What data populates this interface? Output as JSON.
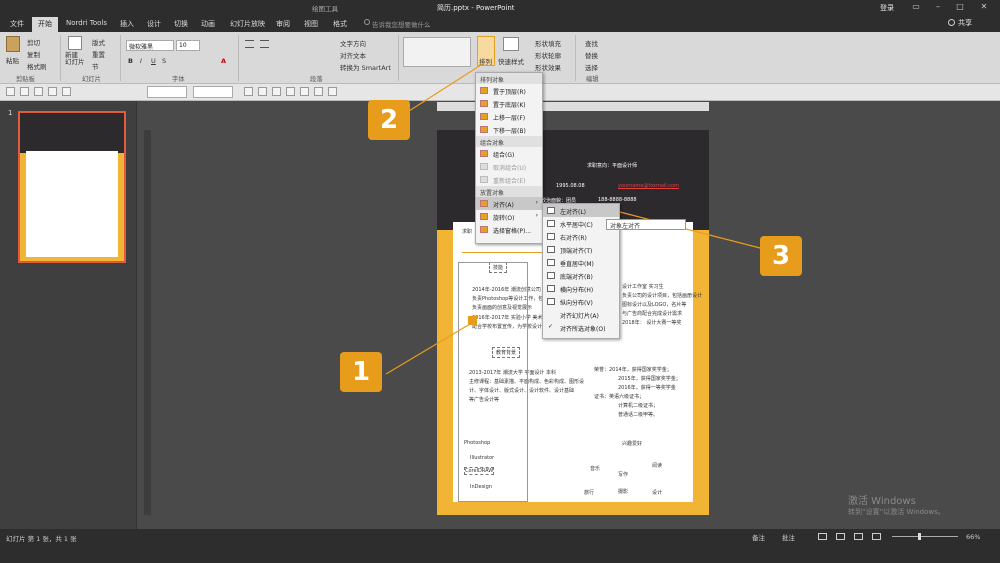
{
  "window": {
    "context_label": "绘图工具",
    "title": "简历.pptx - PowerPoint",
    "sign_in": "登录",
    "share": "共享",
    "tell_me": "告诉我您想要做什么"
  },
  "tabs": [
    "文件",
    "开始",
    "Nordri Tools",
    "插入",
    "设计",
    "切换",
    "动画",
    "幻灯片放映",
    "审阅",
    "视图",
    "格式"
  ],
  "active_tab": "开始",
  "ribbon": {
    "paste": "粘贴",
    "cut": "剪切",
    "copy": "复制",
    "format_painter": "格式刷",
    "new_slide": "新建\n幻灯片",
    "layout": "版式",
    "reset": "重置",
    "section": "节",
    "font_name": "微软雅黑",
    "font_size": "10",
    "text_direction": "文字方向",
    "align_text": "对齐文本",
    "smartart": "转换为 SmartArt",
    "arrange": "排列",
    "quick_styles": "快速样式",
    "shape_fill": "形状填充",
    "shape_outline": "形状轮廓",
    "shape_effects": "形状效果",
    "find": "查找",
    "replace": "替换",
    "select": "选择",
    "groups": [
      "剪贴板",
      "幻灯片",
      "字体",
      "段落",
      "编辑"
    ]
  },
  "thumbnail": {
    "number": "1"
  },
  "slide": {
    "objective": "求职意向：平面设计师",
    "birth": "1995.08.08",
    "email": "yourname@foxmail.com",
    "politics": "政治面貌：团员",
    "phone": "188-8888-8888",
    "name_label": "求职",
    "section_skills": "技能",
    "line1": "2014年-2016年    潮流创意公司",
    "line2": "负责Photoshop等设计工作，包括海报设计，",
    "line3": "负责画面的创意及视觉展示",
    "line4": "2016年-2017年    实验小学    美术",
    "line5": "配合学校布置宣传，为学校设计",
    "section_edu": "教育背景",
    "edu1": "2013-2017年   潮流大学   平面设计   本科",
    "edu2": "主修课程：基础素描、平面构成、色彩构成、图形设",
    "edu3": "计、字体设计、版式设计、设计软件、设计基础",
    "edu4": "等广告设计等",
    "right1": "设计工作室    实习生",
    "right2": "负责公司的设计项目，包括画册设计",
    "right3": "图标设计以及LOGO，名片等",
    "right4": "与广告商配合完成设计需求",
    "right5": "2018年：   设计大赛一等奖",
    "honor1": "荣誉：2014年，获得国家奖学金；",
    "honor2": "2015年，获得国家奖学金；",
    "honor3": "2016年，获得一等奖学金",
    "honor4": "证书：英语六级证书；",
    "honor5": "计算机二级证书；",
    "honor6": "普通话二级甲等。",
    "interest": "兴趣爱好",
    "hobby1": "音乐",
    "hobby2": "写作",
    "hobby3": "阅读",
    "hobby4": "旅行",
    "hobby5": "摄影",
    "hobby6": "设计",
    "sw1": "Photoshop",
    "sw2": "Illustrator",
    "sw3": "CorelDRAW",
    "sw4": "InDesign"
  },
  "arrange_menu": {
    "h_order": "排列对象",
    "bring_front": "置于顶层(R)",
    "send_back": "置于底层(K)",
    "forward": "上移一层(F)",
    "backward": "下移一层(B)",
    "h_group": "组合对象",
    "group": "组合(G)",
    "ungroup": "取消组合(U)",
    "regroup": "重新组合(E)",
    "h_position": "放置对象",
    "align": "对齐(A)",
    "rotate": "旋转(O)",
    "selection_pane": "选择窗格(P)..."
  },
  "align_menu": {
    "left": "左对齐(L)",
    "center": "水平居中(C)",
    "right": "右对齐(R)",
    "top": "顶端对齐(T)",
    "middle": "垂直居中(M)",
    "bottom": "底端对齐(B)",
    "dist_h": "横向分布(H)",
    "dist_v": "纵向分布(V)",
    "to_slide": "对齐幻灯片(A)",
    "to_selected": "对齐所选对象(O)"
  },
  "tooltip": "对象左对齐",
  "badges": [
    "1",
    "2",
    "3"
  ],
  "status": {
    "slide_count": "幻灯片 第 1 张，共 1 张",
    "notes": "备注",
    "comments": "批注",
    "zoom": "66%"
  },
  "watermark": {
    "line1": "激活 Windows",
    "line2": "转到“设置”以激活 Windows。"
  },
  "colors": {
    "accent": "#e89c1c",
    "titlebar": "#2d2d2d",
    "ribbon": "#d9d9d9",
    "slide_orange": "#f1b434",
    "slide_dark": "#2d2a2e"
  }
}
